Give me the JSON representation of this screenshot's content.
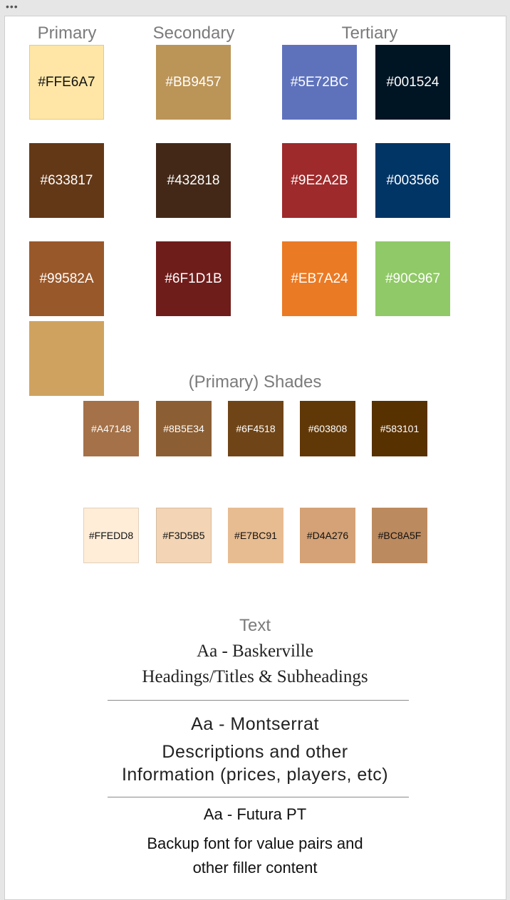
{
  "window": {
    "menu_icon": "ellipsis-icon",
    "menu_glyph": "•••"
  },
  "headings": {
    "primary": "Primary",
    "secondary": "Secondary",
    "tertiary": "Tertiary",
    "shades": "(Primary) Shades",
    "text": "Text"
  },
  "colors": {
    "primary": [
      {
        "hex": "#FFE6A7",
        "label": "#FFE6A7",
        "text_color": "#111111"
      },
      {
        "hex": "#633817",
        "label": "#633817",
        "text_color": "#ffffff"
      },
      {
        "hex": "#99582A",
        "label": "#99582A",
        "text_color": "#ffffff"
      },
      {
        "hex": "#CFA35F",
        "label": "",
        "text_color": "#ffffff"
      }
    ],
    "secondary": [
      {
        "hex": "#BB9457",
        "label": "#BB9457",
        "text_color": "#ffffff"
      },
      {
        "hex": "#432818",
        "label": "#432818",
        "text_color": "#ffffff"
      },
      {
        "hex": "#6F1D1B",
        "label": "#6F1D1B",
        "text_color": "#ffffff"
      }
    ],
    "tertiary": [
      {
        "hex": "#5E72BC",
        "label": "#5E72BC",
        "text_color": "#ffffff"
      },
      {
        "hex": "#001524",
        "label": "#001524",
        "text_color": "#ffffff"
      },
      {
        "hex": "#9E2A2B",
        "label": "#9E2A2B",
        "text_color": "#ffffff"
      },
      {
        "hex": "#003566",
        "label": "#003566",
        "text_color": "#ffffff"
      },
      {
        "hex": "#EB7A24",
        "label": "#EB7A24",
        "text_color": "#ffffff"
      },
      {
        "hex": "#90C967",
        "label": "#90C967",
        "text_color": "#ffffff"
      }
    ],
    "shades_dark": [
      {
        "hex": "#A47148",
        "label": "#A47148",
        "text_color": "#ffffff"
      },
      {
        "hex": "#8B5E34",
        "label": "#8B5E34",
        "text_color": "#ffffff"
      },
      {
        "hex": "#6F4518",
        "label": "#6F4518",
        "text_color": "#ffffff"
      },
      {
        "hex": "#603808",
        "label": "#603808",
        "text_color": "#ffffff"
      },
      {
        "hex": "#583101",
        "label": "#583101",
        "text_color": "#ffffff"
      }
    ],
    "shades_light": [
      {
        "hex": "#FFEDD8",
        "label": "#FFEDD8",
        "text_color": "#111111"
      },
      {
        "hex": "#F3D5B5",
        "label": "#F3D5B5",
        "text_color": "#111111"
      },
      {
        "hex": "#E7BC91",
        "label": "#E7BC91",
        "text_color": "#111111"
      },
      {
        "hex": "#D4A276",
        "label": "#D4A276",
        "text_color": "#111111"
      },
      {
        "hex": "#BC8A5F",
        "label": "#BC8A5F",
        "text_color": "#111111"
      }
    ]
  },
  "typography": {
    "baskerville_title": "Aa - Baskerville",
    "baskerville_desc": "Headings/Titles & Subheadings",
    "montserrat_title": "Aa - Montserrat",
    "montserrat_desc_1": "Descriptions and other",
    "montserrat_desc_2": "Information (prices, players, etc)",
    "futura_title": "Aa - Futura PT",
    "futura_desc_1": "Backup font for value pairs and",
    "futura_desc_2": "other filler content"
  }
}
